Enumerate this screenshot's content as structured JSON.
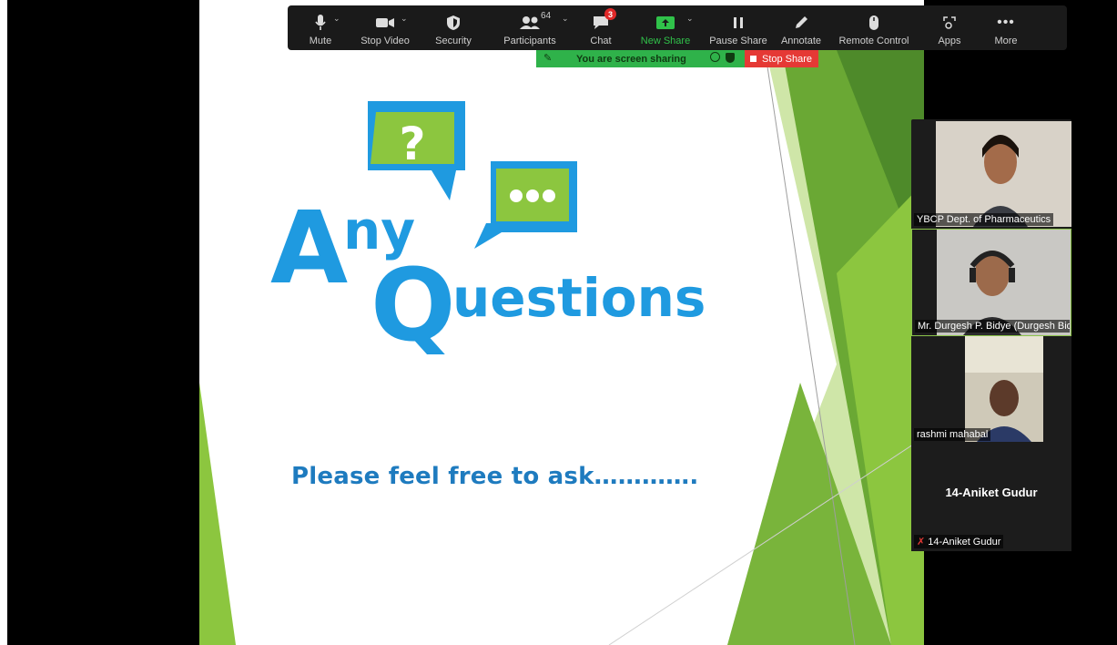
{
  "toolbar": {
    "mute": "Mute",
    "stop_video": "Stop Video",
    "security": "Security",
    "participants": "Participants",
    "participants_count": "64",
    "chat": "Chat",
    "chat_badge": "3",
    "new_share": "New Share",
    "pause_share": "Pause Share",
    "annotate": "Annotate",
    "remote_control": "Remote Control",
    "apps": "Apps",
    "more": "More"
  },
  "share_banner": {
    "text": "You are screen sharing",
    "stop": "Stop Share"
  },
  "slide": {
    "logo_line1": "ny",
    "logo_a": "A",
    "logo_q": "Q",
    "logo_line2": "uestions",
    "question_mark": "?",
    "tagline": "Please feel free to ask…………."
  },
  "participants_panel": [
    {
      "name": "YBCP Dept. of Pharmaceutics"
    },
    {
      "name": "Mr. Durgesh P. Bidye (Durgesh Bidy..."
    },
    {
      "name": "rashmi mahabal"
    },
    {
      "name": "14-Aniket Gudur",
      "big_name": "14-Aniket Gudur"
    }
  ],
  "colors": {
    "accent_green": "#30c24a",
    "stop_red": "#e53935",
    "logo_blue": "#1f9ae0",
    "logo_green": "#8cc63f"
  }
}
